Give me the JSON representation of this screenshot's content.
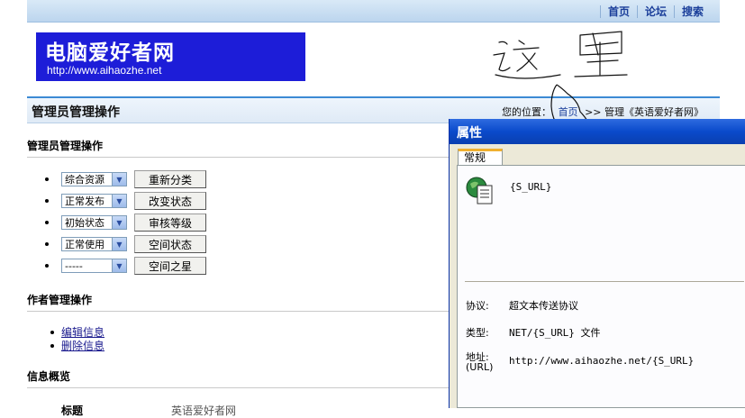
{
  "topnav": {
    "items": [
      "首页",
      "论坛",
      "搜索"
    ]
  },
  "logo": {
    "name": "电脑爱好者网",
    "url": "http://www.aihaozhe.net"
  },
  "annotation": {
    "handwriting": "这里"
  },
  "header": {
    "title": "管理员管理操作",
    "location_label": "您的位置：",
    "location_home": "首页",
    "location_rest": ">> 管理《英语爱好者网》"
  },
  "admin_section": {
    "heading": "管理员管理操作",
    "rows": [
      {
        "select": "综合资源",
        "button": "重新分类"
      },
      {
        "select": "正常发布",
        "button": "改变状态"
      },
      {
        "select": "初始状态",
        "button": "审核等级"
      },
      {
        "select": "正常使用",
        "button": "空间状态"
      },
      {
        "select": "-----",
        "button": "空间之星"
      }
    ]
  },
  "author_section": {
    "heading": "作者管理操作",
    "links": [
      "编辑信息",
      "删除信息"
    ]
  },
  "info_section": {
    "heading": "信息概览",
    "row_label": "标题",
    "row_value": "英语爱好者网"
  },
  "dialog": {
    "title": "属性",
    "tab": "常规",
    "name": "{S_URL}",
    "protocol_label": "协议:",
    "protocol_value": "超文本传送协议",
    "type_label": "类型:",
    "type_value": "NET/{S_URL} 文件",
    "address_label": "地址:",
    "address_label2": "(URL)",
    "address_value": "http://www.aihaozhe.net/{S_URL}"
  }
}
